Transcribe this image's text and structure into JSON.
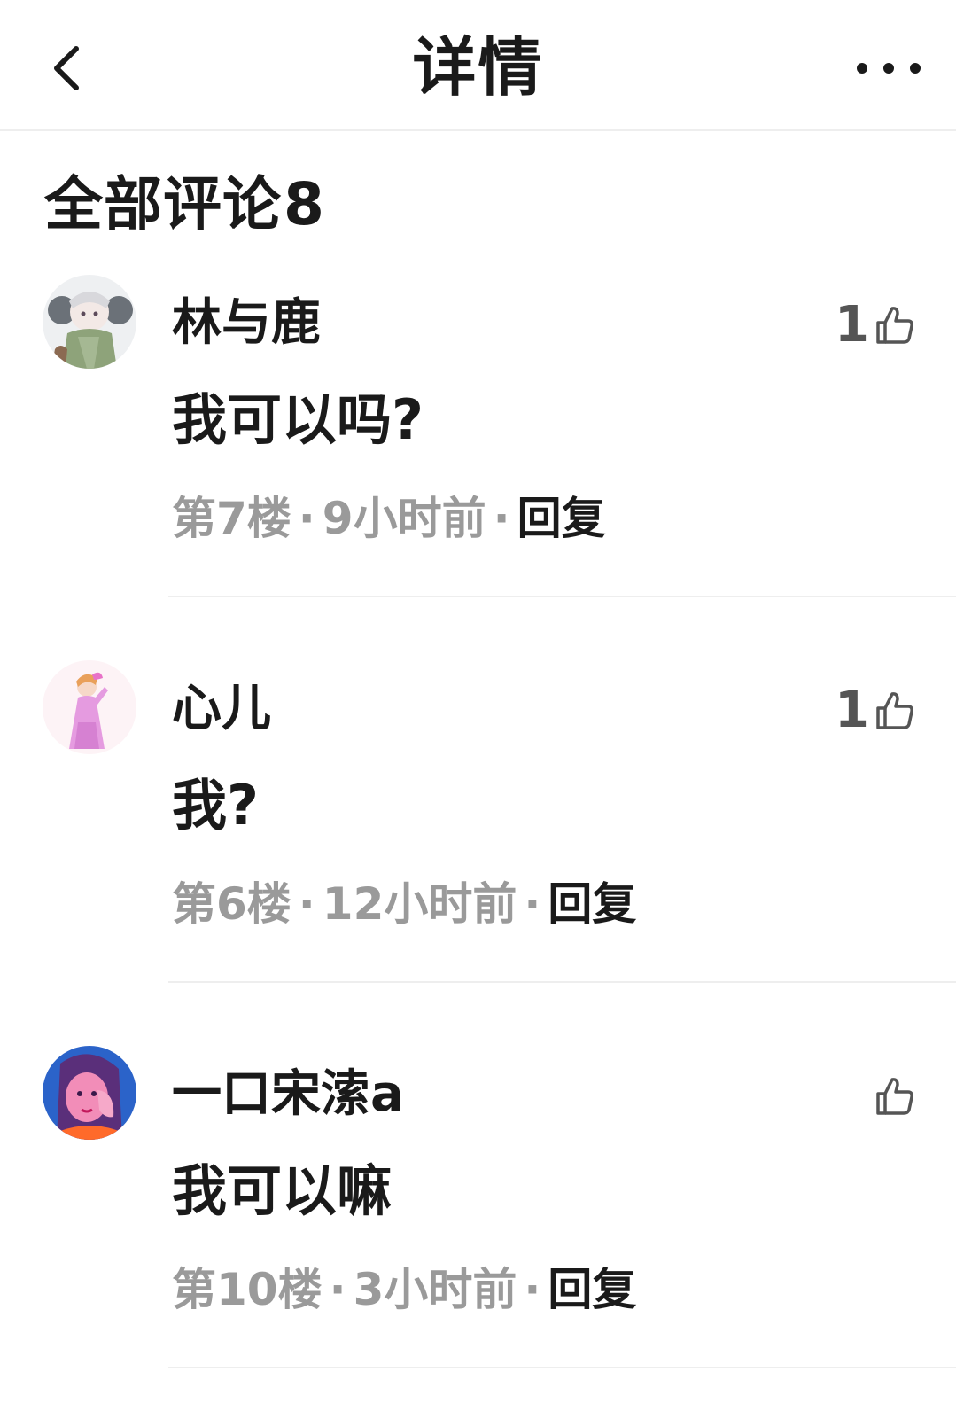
{
  "nav": {
    "back_icon": "chevron-left-icon",
    "title": "详情",
    "more_icon": "more-horizontal-icon"
  },
  "section": {
    "title": "全部评论",
    "count": "8"
  },
  "comments": [
    {
      "username": "林与鹿",
      "likes": "1",
      "text": "我可以吗?",
      "floor": "第7楼",
      "time": "9小时前",
      "reply_label": "回复",
      "avatar_icon": "anime-avatar-scarf"
    },
    {
      "username": "心儿",
      "likes": "1",
      "text": "我?",
      "floor": "第6楼",
      "time": "12小时前",
      "reply_label": "回复",
      "avatar_icon": "anime-avatar-pink-dress"
    },
    {
      "username": "一口宋溹a",
      "likes": "",
      "text": "我可以嘛",
      "floor": "第10楼",
      "time": "3小时前",
      "reply_label": "回复",
      "avatar_icon": "illustrated-avatar-blue"
    }
  ],
  "meta_separator": "·",
  "colors": {
    "text": "#1a1a1a",
    "meta": "#9a9a9a",
    "divider": "#eeeeee",
    "like_icon": "#555555"
  }
}
